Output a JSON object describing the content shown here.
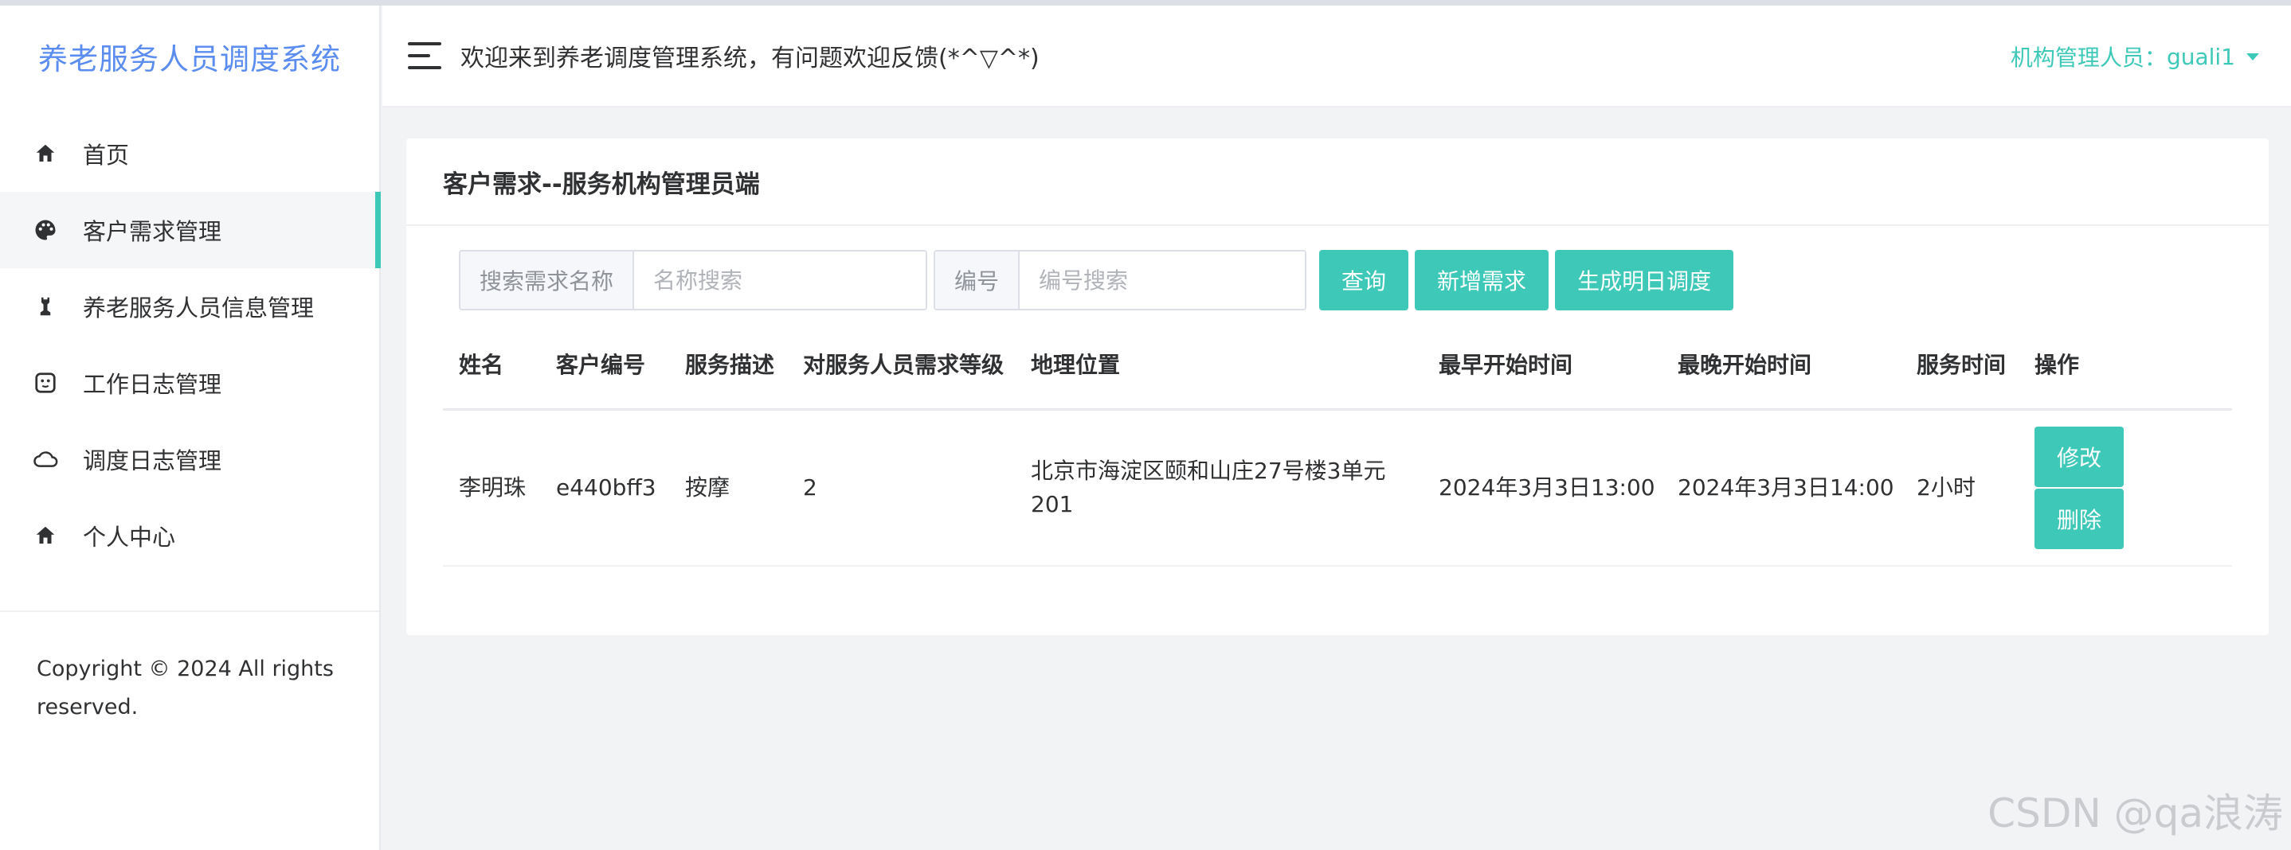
{
  "sidebar": {
    "brand": "养老服务人员调度系统",
    "items": [
      {
        "label": "首页",
        "icon": "home-icon"
      },
      {
        "label": "客户需求管理",
        "icon": "palette-icon"
      },
      {
        "label": "养老服务人员信息管理",
        "icon": "chess-icon"
      },
      {
        "label": "工作日志管理",
        "icon": "face-icon"
      },
      {
        "label": "调度日志管理",
        "icon": "cloud-icon"
      },
      {
        "label": "个人中心",
        "icon": "home-icon"
      }
    ],
    "active_index": 1,
    "copyright": "Copyright © 2024 All rights reserved."
  },
  "header": {
    "welcome": "欢迎来到养老调度管理系统，有问题欢迎反馈(*^▽^*)",
    "user_label": "机构管理人员：",
    "username": "guali1"
  },
  "page": {
    "title": "客户需求--服务机构管理员端",
    "search_name_label": "搜索需求名称",
    "search_name_placeholder": "名称搜索",
    "search_id_label": "编号",
    "search_id_placeholder": "编号搜索",
    "btn_query": "查询",
    "btn_add": "新增需求",
    "btn_generate": "生成明日调度"
  },
  "table": {
    "columns": [
      "姓名",
      "客户编号",
      "服务描述",
      "对服务人员需求等级",
      "地理位置",
      "最早开始时间",
      "最晚开始时间",
      "服务时间",
      "操作"
    ],
    "rows": [
      {
        "name": "李明珠",
        "customer_id": "e440bff3",
        "description": "按摩",
        "level": "2",
        "location": "北京市海淀区颐和山庄27号楼3单元201",
        "earliest": "2024年3月3日13:00",
        "latest": "2024年3月3日14:00",
        "duration": "2小时",
        "edit_label": "修改",
        "delete_label": "删除"
      }
    ]
  },
  "watermark": "CSDN @qa浪涛",
  "colors": {
    "accent": "#3ec8b8",
    "brand": "#5b8cf0"
  }
}
